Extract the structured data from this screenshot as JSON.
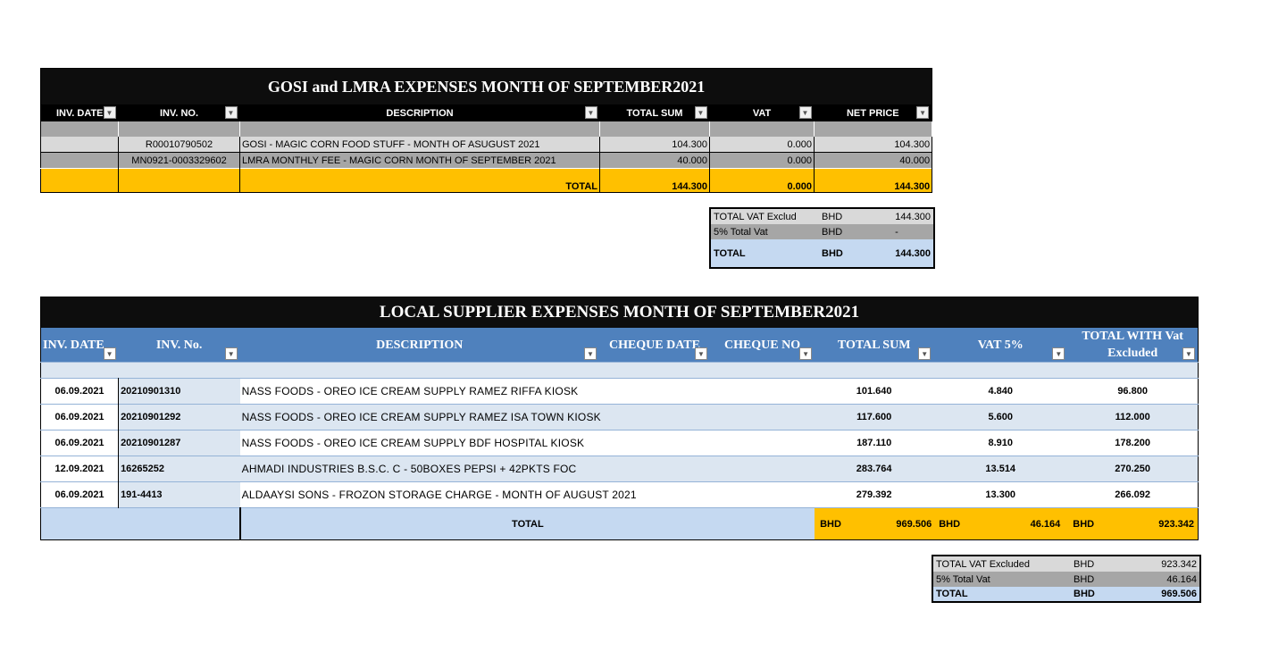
{
  "gosi": {
    "title": "GOSI and  LMRA  EXPENSES  MONTH OF SEPTEMBER2021",
    "headers": [
      "INV. DATE",
      "INV. NO.",
      "DESCRIPTION",
      "TOTAL SUM",
      "VAT",
      "NET PRICE"
    ],
    "rows": [
      {
        "date": "",
        "inv": "R00010790502",
        "desc": "GOSI  - MAGIC CORN FOOD STUFF  - MONTH OF ASUGUST  2021",
        "total": "104.300",
        "vat": "0.000",
        "net": "104.300"
      },
      {
        "date": "",
        "inv": "MN0921-0003329602",
        "desc": "LMRA  MONTHLY FEE  - MAGIC CORN MONTH OF SEPTEMBER 2021",
        "total": "40.000",
        "vat": "0.000",
        "net": "40.000"
      }
    ],
    "total": {
      "label": "TOTAL",
      "total": "144.300",
      "vat": "0.000",
      "net": "144.300"
    },
    "summary": [
      {
        "label": "TOTAL VAT Exclud",
        "cur": "BHD",
        "value": "144.300"
      },
      {
        "label": "5% Total Vat",
        "cur": "BHD",
        "value": "-"
      },
      {
        "label": "TOTAL",
        "cur": "BHD",
        "value": "144.300"
      }
    ]
  },
  "local": {
    "title": "LOCAL SUPPLIER EXPENSES  MONTH OF SEPTEMBER2021",
    "headers": [
      "INV. DATE",
      "INV. No.",
      "DESCRIPTION",
      "CHEQUE DATE",
      "CHEQUE NO",
      "TOTAL SUM",
      "VAT  5%",
      "TOTAL WITH Vat Excluded"
    ],
    "rows": [
      {
        "date": "06.09.2021",
        "inv": "20210901310",
        "desc": "NASS FOODS - OREO ICE CREAM   SUPPLY RAMEZ RIFFA  KIOSK",
        "total": "101.640",
        "vat": "4.840",
        "net": "96.800"
      },
      {
        "date": "06.09.2021",
        "inv": "20210901292",
        "desc": "NASS FOODS - OREO ICE CREAM   SUPPLY RAMEZ ISA TOWN   KIOSK",
        "total": "117.600",
        "vat": "5.600",
        "net": "112.000"
      },
      {
        "date": "06.09.2021",
        "inv": "20210901287",
        "desc": "NASS FOODS - OREO ICE CREAM   SUPPLY BDF HOSPITAL   KIOSK",
        "total": "187.110",
        "vat": "8.910",
        "net": "178.200"
      },
      {
        "date": "12.09.2021",
        "inv": "16265252",
        "desc": "AHMADI  INDUSTRIES  B.S.C. C - 50BOXES PEPSI  + 42PKTS FOC",
        "total": "283.764",
        "vat": "13.514",
        "net": "270.250"
      },
      {
        "date": "06.09.2021",
        "inv": "191-4413",
        "desc": "ALDAAYSI SONS - FROZON STORAGE CHARGE  - MONTH OF AUGUST 2021",
        "total": "279.392",
        "vat": "13.300",
        "net": "266.092"
      }
    ],
    "total": {
      "label": "TOTAL",
      "cur": "BHD",
      "total": "969.506",
      "vat": "46.164",
      "net": "923.342"
    },
    "summary": [
      {
        "label": "TOTAL VAT Excluded",
        "cur": "BHD",
        "value": "923.342"
      },
      {
        "label": "5% Total Vat",
        "cur": "BHD",
        "value": "46.164"
      },
      {
        "label": "TOTAL",
        "cur": "BHD",
        "value": "969.506"
      }
    ]
  },
  "colors": {
    "header_black": "#0d0d0d",
    "header_blue": "#4f81bd",
    "total_yellow": "#ffc000",
    "light_blue": "#dce6f1",
    "summary_blue": "#c5d9f1"
  }
}
